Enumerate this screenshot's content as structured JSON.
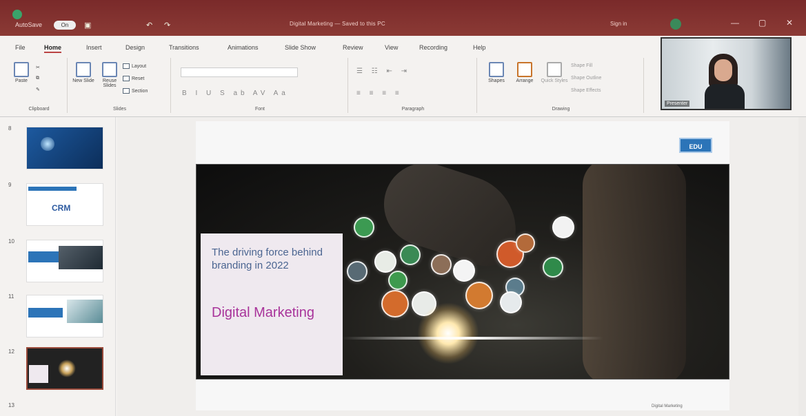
{
  "titlebar": {
    "autosave_label": "AutoSave",
    "autosave_state": "On",
    "document_title": "Digital Marketing — Saved to this PC",
    "user_name": "Sign in",
    "icons": [
      "app-icon",
      "save-icon",
      "undo-icon",
      "redo-icon",
      "minimize-icon",
      "restore-icon",
      "close-icon"
    ]
  },
  "tabs": [
    "File",
    "Home",
    "Insert",
    "Design",
    "Transitions",
    "Animations",
    "Slide Show",
    "Review",
    "View",
    "Recording",
    "Help"
  ],
  "active_tab": "Home",
  "ribbon": {
    "clipboard": {
      "paste": "Paste",
      "label": "Clipboard"
    },
    "slides": {
      "new_slide": "New Slide",
      "reuse": "Reuse Slides",
      "layout": "Layout",
      "reset": "Reset",
      "section": "Section",
      "label": "Slides"
    },
    "font": {
      "label": "Font"
    },
    "paragraph": {
      "label": "Paragraph"
    },
    "drawing": {
      "shapes": "Shapes",
      "arrange": "Arrange",
      "quick_styles": "Quick Styles",
      "shape_fill": "Shape Fill",
      "shape_outline": "Shape Outline",
      "shape_effects": "Shape Effects",
      "label": "Drawing"
    }
  },
  "video": {
    "participant": "Presenter"
  },
  "slides_panel": {
    "numbers": [
      "8",
      "9",
      "10",
      "11",
      "12",
      "13"
    ],
    "selected_index": 4,
    "thumb9_text": "CRM"
  },
  "slide": {
    "logo": "EDU",
    "subtitle": "The driving force behind branding in 2022",
    "headline": "Digital Marketing",
    "footer": "Digital Marketing"
  },
  "colors": {
    "titlebar": "#8b3a35",
    "subtitle": "#4b6591",
    "headline": "#a8339a",
    "logo_bg": "#2c74b8"
  }
}
